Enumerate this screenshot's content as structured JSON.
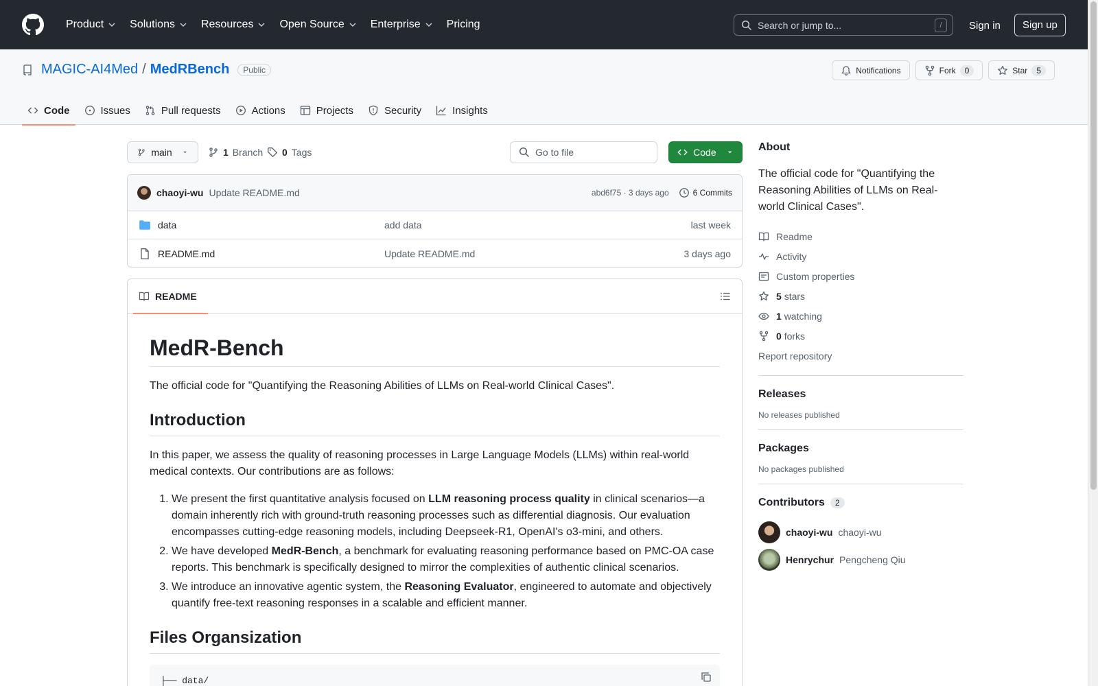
{
  "header": {
    "nav": [
      {
        "label": "Product",
        "has_menu": true
      },
      {
        "label": "Solutions",
        "has_menu": true
      },
      {
        "label": "Resources",
        "has_menu": true
      },
      {
        "label": "Open Source",
        "has_menu": true
      },
      {
        "label": "Enterprise",
        "has_menu": true
      },
      {
        "label": "Pricing",
        "has_menu": false
      }
    ],
    "search_placeholder": "Search or jump to...",
    "search_shortcut": "/",
    "sign_in": "Sign in",
    "sign_up": "Sign up"
  },
  "repo": {
    "owner": "MAGIC-AI4Med",
    "separator": "/",
    "name": "MedRBench",
    "visibility": "Public",
    "notifications_label": "Notifications",
    "fork_label": "Fork",
    "fork_count": "0",
    "star_label": "Star",
    "star_count": "5",
    "tabs": [
      {
        "label": "Code",
        "icon": "code-icon",
        "active": true
      },
      {
        "label": "Issues",
        "icon": "issue-icon",
        "active": false
      },
      {
        "label": "Pull requests",
        "icon": "pull-request-icon",
        "active": false
      },
      {
        "label": "Actions",
        "icon": "play-icon",
        "active": false
      },
      {
        "label": "Projects",
        "icon": "table-icon",
        "active": false
      },
      {
        "label": "Security",
        "icon": "shield-icon",
        "active": false
      },
      {
        "label": "Insights",
        "icon": "graph-icon",
        "active": false
      }
    ]
  },
  "branch_bar": {
    "branch": "main",
    "branch_count": "1",
    "branch_label": "Branch",
    "tag_count": "0",
    "tag_label": "Tags",
    "goto_placeholder": "Go to file",
    "code_button": "Code"
  },
  "latest_commit": {
    "author": "chaoyi-wu",
    "message": "Update README.md",
    "meta": "abd6f75 · 3 days ago",
    "commits_label": "6 Commits"
  },
  "files": [
    {
      "name": "data",
      "type": "folder",
      "commit": "add data",
      "time": "last week"
    },
    {
      "name": "README.md",
      "type": "file",
      "commit": "Update README.md",
      "time": "3 days ago"
    }
  ],
  "readme": {
    "tab_label": "README",
    "title": "MedR-Bench",
    "intro": "The official code for \"Quantifying the Reasoning Abilities of LLMs on Real-world Clinical Cases\".",
    "h_introduction": "Introduction",
    "intro_paragraph": "In this paper, we assess the quality of reasoning processes in Large Language Models (LLMs) within real-world medical contexts. Our contributions are as follows:",
    "list": [
      {
        "pre": "We present the first quantitative analysis focused on ",
        "bold": "LLM reasoning process quality",
        "post": " in clinical scenarios—a domain inherently rich with ground-truth reasoning processes such as differential diagnosis. Our evaluation encompasses cutting-edge reasoning models, including Deepseek-R1, OpenAI's o3-mini, and others."
      },
      {
        "pre": "We have developed ",
        "bold": "MedR-Bench",
        "post": ", a benchmark for evaluating reasoning performance based on PMC-OA case reports. This benchmark is specifically designed to mirror the complexities of authentic clinical scenarios."
      },
      {
        "pre": "We introduce an innovative agentic system, the ",
        "bold": "Reasoning Evaluator",
        "post": ", engineered to automate and objectively quantify free-text reasoning responses in a scalable and efficient manner."
      }
    ],
    "h_files": "Files Organsization",
    "code_first_line": "├── data/"
  },
  "about": {
    "heading": "About",
    "description": "The official code for \"Quantifying the Reasoning Abilities of LLMs on Real-world Clinical Cases\".",
    "readme": "Readme",
    "activity": "Activity",
    "custom_properties": "Custom properties",
    "stars_count": "5",
    "stars_label": "stars",
    "watching_count": "1",
    "watching_label": "watching",
    "forks_count": "0",
    "forks_label": "forks",
    "report": "Report repository"
  },
  "releases": {
    "heading": "Releases",
    "empty": "No releases published"
  },
  "packages": {
    "heading": "Packages",
    "empty": "No packages published"
  },
  "contributors": {
    "heading": "Contributors",
    "count": "2",
    "list": [
      {
        "login": "chaoyi-wu",
        "name": "chaoyi-wu"
      },
      {
        "login": "Henrychur",
        "name": "Pengcheng Qiu"
      }
    ]
  },
  "colors": {
    "header_bg": "#24292f",
    "link": "#0969da",
    "primary_button": "#1f883d",
    "active_tab_underline": "#fd8c73"
  }
}
